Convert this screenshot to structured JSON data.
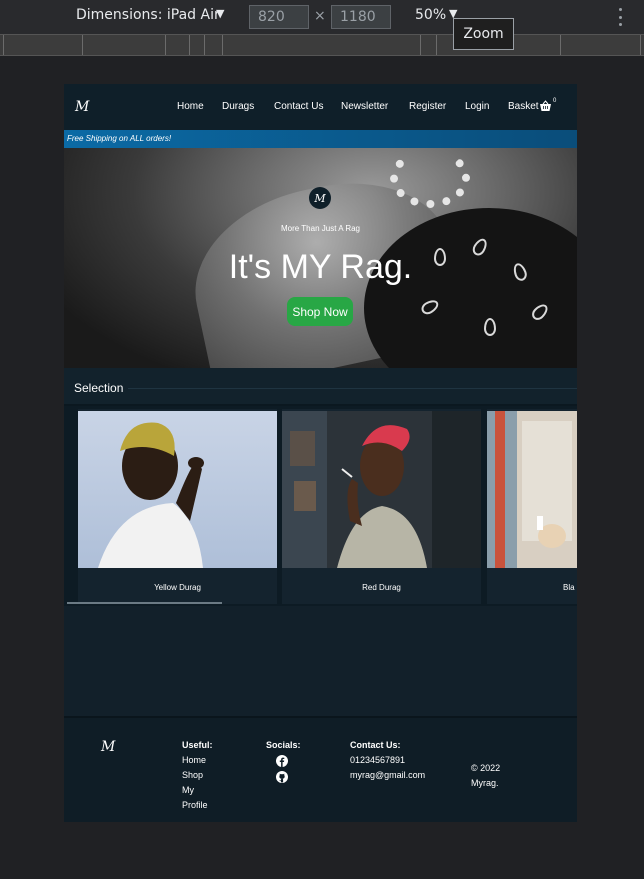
{
  "devtools": {
    "dimensions_label": "Dimensions: iPad Air",
    "width_value": "820",
    "height_value": "1180",
    "times": "×",
    "zoom_value": "50%",
    "tooltip": "Zoom"
  },
  "site": {
    "logo": "M",
    "nav": {
      "home": "Home",
      "durags": "Durags",
      "contact": "Contact Us",
      "newsletter": "Newsletter",
      "register": "Register",
      "login": "Login",
      "basket": "Basket",
      "basket_count": "0"
    },
    "shipping_banner": "Free Shipping on ALL orders!",
    "hero": {
      "logo": "M",
      "tagline": "More Than Just A Rag",
      "title": "It's MY Rag.",
      "button": "Shop Now"
    },
    "selection": {
      "title": "Selection",
      "cards": [
        {
          "label": "Yellow Durag"
        },
        {
          "label": "Red Durag"
        },
        {
          "label": "Bla"
        }
      ]
    },
    "footer": {
      "logo": "M",
      "useful_heading": "Useful:",
      "useful_links": [
        "Home",
        "Shop",
        "My",
        "Profile"
      ],
      "socials_heading": "Socials:",
      "contact_heading": "Contact Us:",
      "phone": "01234567891",
      "email": "myrag@gmail.com",
      "copyright_line1": "© 2022",
      "copyright_line2": "Myrag."
    }
  },
  "colors": {
    "accent_green": "#28a745",
    "banner_blue": "#0b6aa5",
    "nav_bg": "#0f1f29"
  }
}
